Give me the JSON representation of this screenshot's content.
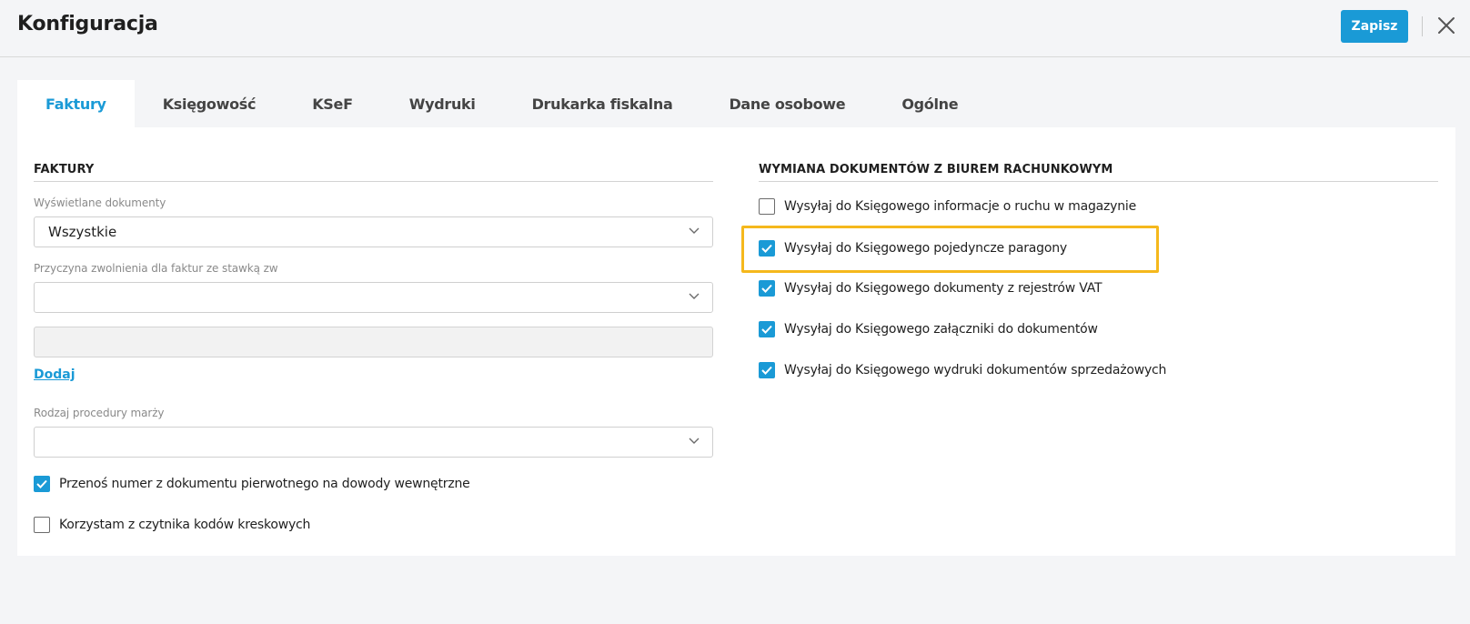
{
  "header": {
    "title": "Konfiguracja",
    "save_label": "Zapisz",
    "close_icon": "close-icon"
  },
  "tabs": [
    {
      "label": "Faktury",
      "active": true
    },
    {
      "label": "Księgowość",
      "active": false
    },
    {
      "label": "KSeF",
      "active": false
    },
    {
      "label": "Wydruki",
      "active": false
    },
    {
      "label": "Drukarka fiskalna",
      "active": false
    },
    {
      "label": "Dane osobowe",
      "active": false
    },
    {
      "label": "Ogólne",
      "active": false
    }
  ],
  "left": {
    "section_title": "FAKTURY",
    "displayed_docs": {
      "label": "Wyświetlane dokumenty",
      "value": "Wszystkie"
    },
    "exemption_reason": {
      "label": "Przyczyna zwolnienia dla faktur ze stawką zw",
      "value": ""
    },
    "add_link": "Dodaj",
    "margin_procedure": {
      "label": "Rodzaj procedury marży",
      "value": ""
    },
    "checkboxes": [
      {
        "label": "Przenoś numer z dokumentu pierwotnego na dowody wewnętrzne",
        "checked": true
      },
      {
        "label": "Korzystam z czytnika kodów kreskowych",
        "checked": false
      }
    ]
  },
  "right": {
    "section_title": "WYMIANA DOKUMENTÓW Z BIUREM RACHUNKOWYM",
    "checkboxes": [
      {
        "label": "Wysyłaj do Księgowego informacje o ruchu w magazynie",
        "checked": false
      },
      {
        "label": "Wysyłaj do Księgowego pojedyncze paragony",
        "checked": true
      },
      {
        "label": "Wysyłaj do Księgowego dokumenty z rejestrów VAT",
        "checked": true
      },
      {
        "label": "Wysyłaj do Księgowego załączniki do dokumentów",
        "checked": true
      },
      {
        "label": "Wysyłaj do Księgowego wydruki dokumentów sprzedażowych",
        "checked": true
      }
    ]
  },
  "colors": {
    "accent": "#1a9ad6",
    "highlight": "#f5b81c"
  }
}
